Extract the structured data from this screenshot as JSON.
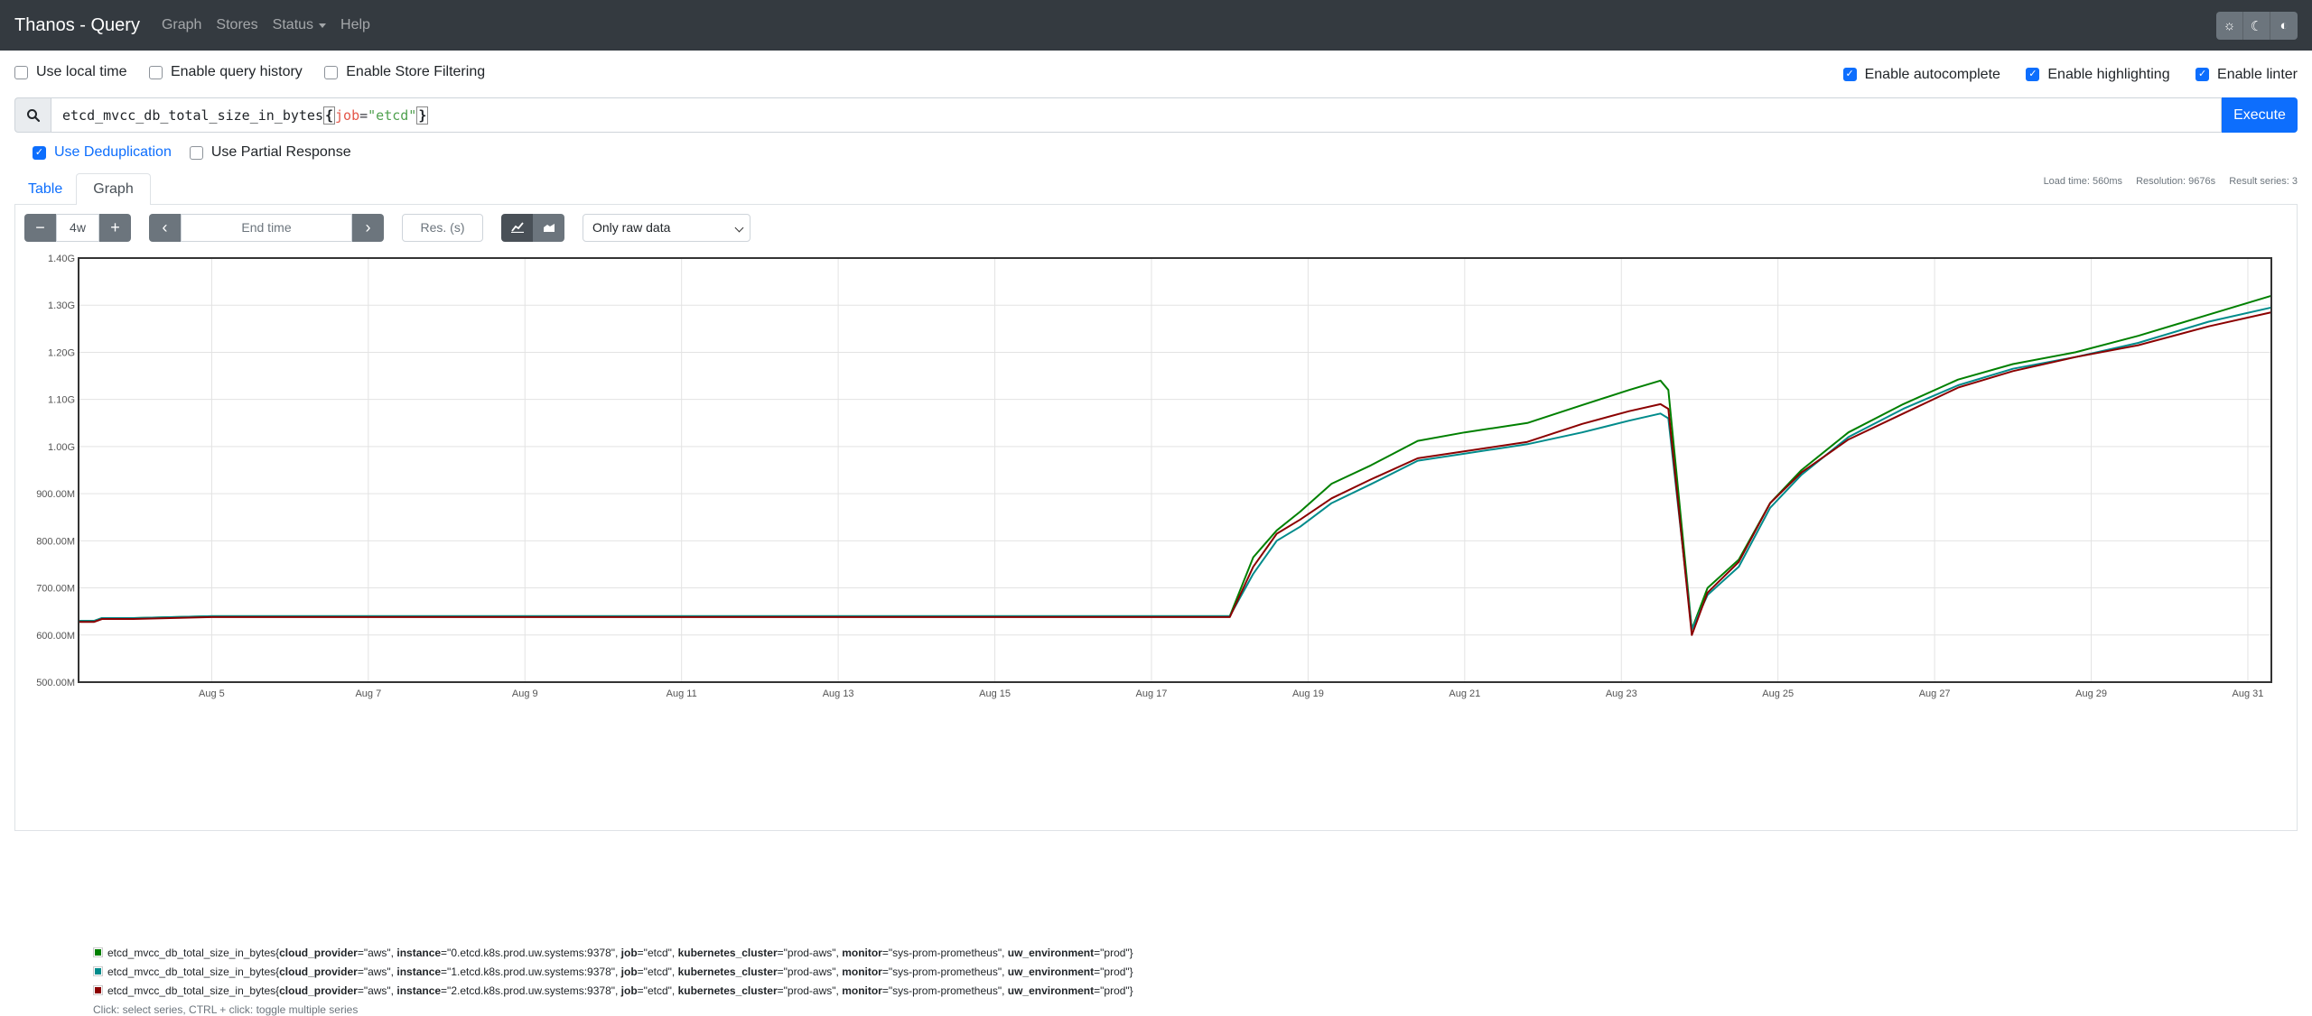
{
  "navbar": {
    "brand": "Thanos - Query",
    "links": [
      "Graph",
      "Stores",
      "Status",
      "Help"
    ],
    "theme_icons": [
      "sun-icon",
      "moon-icon",
      "contrast-icon"
    ]
  },
  "options": {
    "use_local_time": "Use local time",
    "enable_query_history": "Enable query history",
    "enable_store_filtering": "Enable Store Filtering",
    "enable_autocomplete": "Enable autocomplete",
    "enable_highlighting": "Enable highlighting",
    "enable_linter": "Enable linter"
  },
  "query": {
    "metric": "etcd_mvcc_db_total_size_in_bytes",
    "open_brace": "{",
    "label_name": "job",
    "eq": "=",
    "label_value": "\"etcd\"",
    "close_brace": "}",
    "execute_label": "Execute"
  },
  "dedup": {
    "use_deduplication": "Use Deduplication",
    "use_partial_response": "Use Partial Response"
  },
  "tabs": {
    "table": "Table",
    "graph": "Graph"
  },
  "stats": {
    "load_time": "Load time: 560ms",
    "resolution": "Resolution: 9676s",
    "result_series": "Result series: 3"
  },
  "controls": {
    "minus": "−",
    "range": "4w",
    "plus": "+",
    "end_time_placeholder": "End time",
    "res_placeholder": "Res. (s)",
    "mode_select": "Only raw data"
  },
  "chart_data": {
    "type": "line",
    "x_unit": "days (Aug)",
    "xlim": [
      3.3,
      31.3
    ],
    "ylim": [
      500,
      1400
    ],
    "y_unit": "M bytes",
    "y_ticks": [
      500,
      600,
      700,
      800,
      900,
      1000,
      1100,
      1200,
      1300,
      1400
    ],
    "y_tick_labels": [
      "500.00M",
      "600.00M",
      "700.00M",
      "800.00M",
      "900.00M",
      "1.00G",
      "1.10G",
      "1.20G",
      "1.30G",
      "1.40G"
    ],
    "x_ticks": [
      5,
      7,
      9,
      11,
      13,
      15,
      17,
      19,
      21,
      23,
      25,
      27,
      29,
      31
    ],
    "x_tick_labels": [
      "Aug 5",
      "Aug 7",
      "Aug 9",
      "Aug 11",
      "Aug 13",
      "Aug 15",
      "Aug 17",
      "Aug 19",
      "Aug 21",
      "Aug 23",
      "Aug 25",
      "Aug 27",
      "Aug 29",
      "Aug 31"
    ],
    "grid": true,
    "series": [
      {
        "color": "#008000",
        "x": [
          3.3,
          3.5,
          3.6,
          4.0,
          5.0,
          10.0,
          14.3,
          17.0,
          18.0,
          18.3,
          18.6,
          18.9,
          19.3,
          19.8,
          20.4,
          21.0,
          21.8,
          22.5,
          23.1,
          23.5,
          23.6,
          23.9,
          24.1,
          24.5,
          24.9,
          25.3,
          25.9,
          26.6,
          27.3,
          28.0,
          28.8,
          29.6,
          30.5,
          31.3
        ],
        "y": [
          630,
          630,
          636,
          636,
          640,
          640,
          640,
          640,
          640,
          765,
          822,
          862,
          921,
          960,
          1012,
          1030,
          1050,
          1088,
          1120,
          1140,
          1120,
          612,
          700,
          760,
          880,
          950,
          1030,
          1090,
          1142,
          1175,
          1200,
          1235,
          1280,
          1320
        ]
      },
      {
        "color": "#008b8b",
        "x": [
          3.3,
          3.5,
          3.6,
          4.0,
          5.0,
          10.0,
          14.3,
          17.0,
          18.0,
          18.3,
          18.6,
          18.9,
          19.3,
          19.8,
          20.4,
          21.0,
          21.8,
          22.5,
          23.1,
          23.5,
          23.6,
          23.9,
          24.1,
          24.5,
          24.9,
          25.3,
          25.9,
          26.6,
          27.3,
          28.0,
          28.8,
          29.6,
          30.5,
          31.3
        ],
        "y": [
          630,
          630,
          636,
          636,
          640,
          640,
          640,
          640,
          640,
          730,
          800,
          830,
          880,
          920,
          970,
          985,
          1005,
          1030,
          1055,
          1070,
          1060,
          612,
          685,
          745,
          870,
          940,
          1020,
          1080,
          1130,
          1165,
          1190,
          1220,
          1265,
          1295
        ]
      },
      {
        "color": "#8b0000",
        "x": [
          3.3,
          3.5,
          3.6,
          4.0,
          5.0,
          10.0,
          14.3,
          17.0,
          18.0,
          18.3,
          18.6,
          18.9,
          19.3,
          19.8,
          20.4,
          21.0,
          21.8,
          22.5,
          23.1,
          23.5,
          23.6,
          23.9,
          24.1,
          24.5,
          24.9,
          25.3,
          25.9,
          26.6,
          27.3,
          28.0,
          28.8,
          29.6,
          30.5,
          31.3
        ],
        "y": [
          628,
          628,
          634,
          634,
          638,
          638,
          638,
          638,
          638,
          745,
          815,
          845,
          890,
          930,
          975,
          990,
          1010,
          1048,
          1075,
          1090,
          1080,
          600,
          690,
          755,
          880,
          945,
          1015,
          1070,
          1125,
          1160,
          1190,
          1215,
          1255,
          1285
        ]
      }
    ],
    "legend": [
      {
        "color": "#008000",
        "metric": "etcd_mvcc_db_total_size_in_bytes",
        "labels": [
          {
            "k": "cloud_provider",
            "v": "\"aws\""
          },
          {
            "k": "instance",
            "v": "\"0.etcd.k8s.prod.uw.systems:9378\""
          },
          {
            "k": "job",
            "v": "\"etcd\""
          },
          {
            "k": "kubernetes_cluster",
            "v": "\"prod-aws\""
          },
          {
            "k": "monitor",
            "v": "\"sys-prom-prometheus\""
          },
          {
            "k": "uw_environment",
            "v": "\"prod\""
          }
        ]
      },
      {
        "color": "#008b8b",
        "metric": "etcd_mvcc_db_total_size_in_bytes",
        "labels": [
          {
            "k": "cloud_provider",
            "v": "\"aws\""
          },
          {
            "k": "instance",
            "v": "\"1.etcd.k8s.prod.uw.systems:9378\""
          },
          {
            "k": "job",
            "v": "\"etcd\""
          },
          {
            "k": "kubernetes_cluster",
            "v": "\"prod-aws\""
          },
          {
            "k": "monitor",
            "v": "\"sys-prom-prometheus\""
          },
          {
            "k": "uw_environment",
            "v": "\"prod\""
          }
        ]
      },
      {
        "color": "#8b0000",
        "metric": "etcd_mvcc_db_total_size_in_bytes",
        "labels": [
          {
            "k": "cloud_provider",
            "v": "\"aws\""
          },
          {
            "k": "instance",
            "v": "\"2.etcd.k8s.prod.uw.systems:9378\""
          },
          {
            "k": "job",
            "v": "\"etcd\""
          },
          {
            "k": "kubernetes_cluster",
            "v": "\"prod-aws\""
          },
          {
            "k": "monitor",
            "v": "\"sys-prom-prometheus\""
          },
          {
            "k": "uw_environment",
            "v": "\"prod\""
          }
        ]
      }
    ],
    "hint": "Click: select series, CTRL + click: toggle multiple series"
  }
}
